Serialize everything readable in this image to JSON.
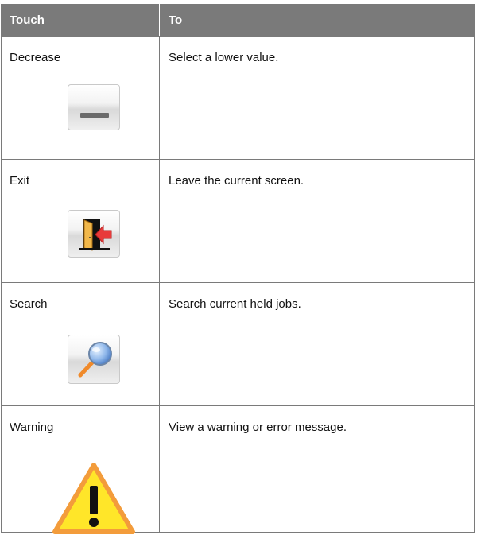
{
  "table": {
    "headers": [
      "Touch",
      "To"
    ],
    "rows": [
      {
        "touch": "Decrease",
        "to": "Select a lower value.",
        "icon": "minus-icon"
      },
      {
        "touch": "Exit",
        "to": "Leave the current screen.",
        "icon": "exit-door-icon"
      },
      {
        "touch": "Search",
        "to": "Search current held jobs.",
        "icon": "magnifier-icon"
      },
      {
        "touch": "Warning",
        "to": "View a warning or error message.",
        "icon": "warning-icon"
      }
    ]
  },
  "colors": {
    "header_bg": "#7a7a7a",
    "header_text": "#ffffff",
    "exit_arrow": "#e83a3a",
    "door": "#f2b84b",
    "warning_fill": "#ffe629",
    "warning_border": "#f39c3b"
  }
}
